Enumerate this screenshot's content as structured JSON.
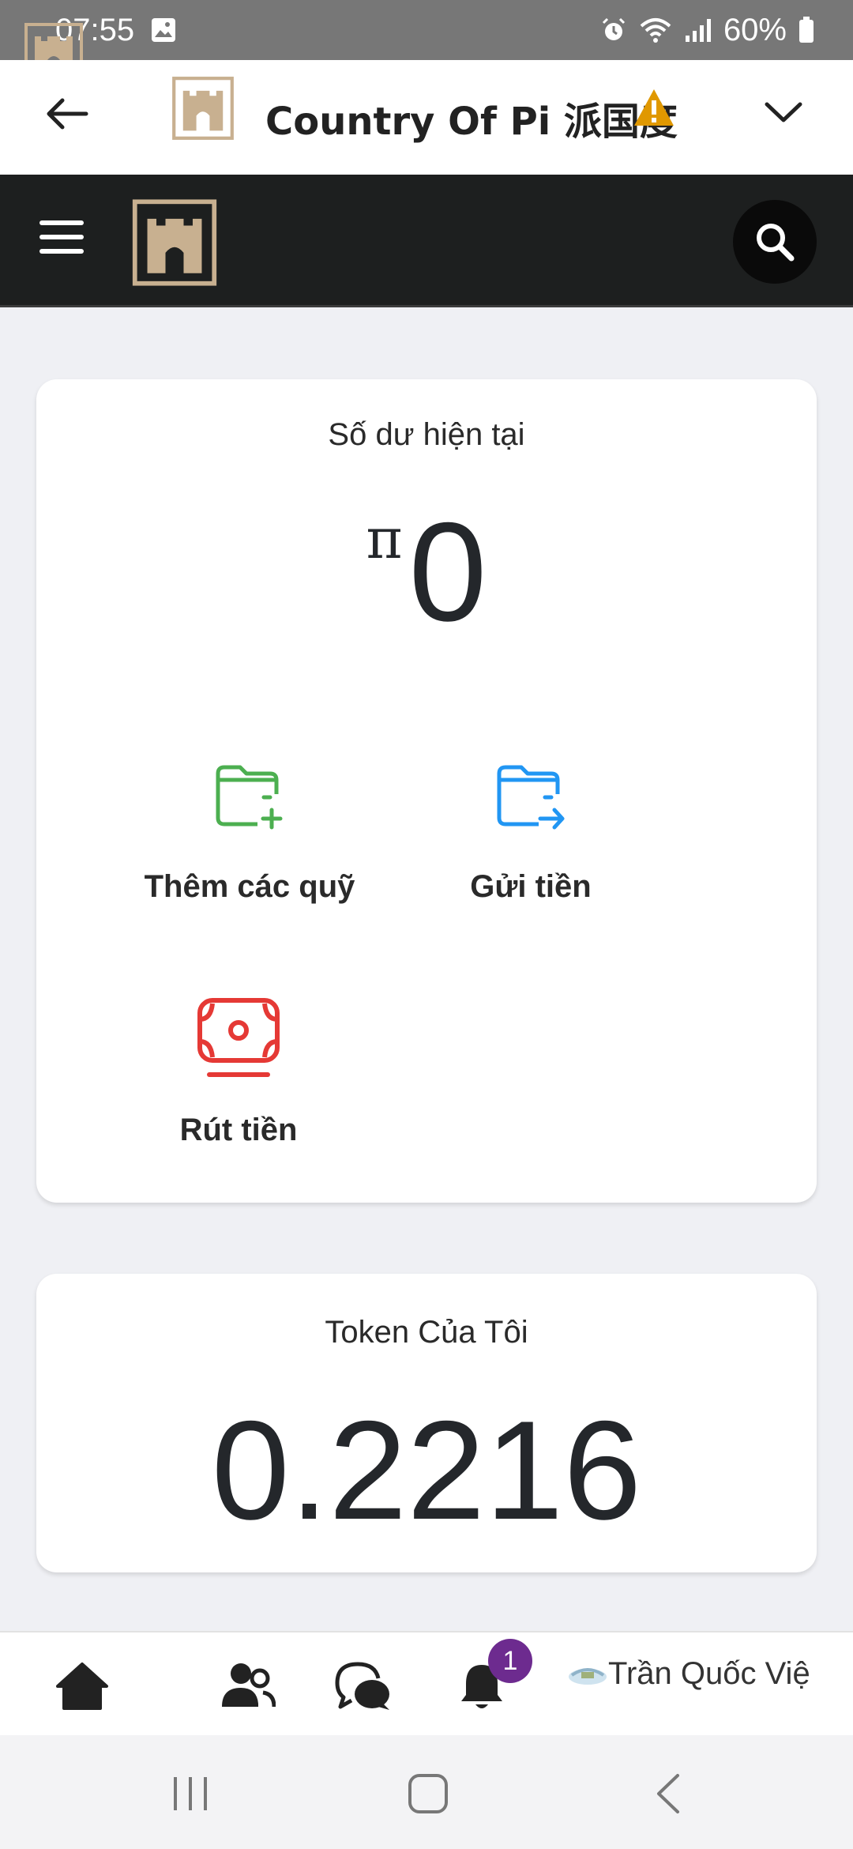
{
  "status_bar": {
    "time": "07:55",
    "battery": "60%",
    "icons": [
      "image-icon",
      "alarm-icon",
      "wifi-icon",
      "signal-icon",
      "battery-icon"
    ]
  },
  "app_bar": {
    "title": "Country Of Pi 派国度",
    "icons": [
      "back-arrow-icon",
      "castle-logo-icon",
      "warning-icon",
      "chevron-down-icon"
    ]
  },
  "site_header": {
    "icons": [
      "hamburger-menu-icon",
      "castle-logo-icon",
      "search-icon"
    ]
  },
  "balance_card": {
    "title": "Số dư hiện tại",
    "currency_symbol": "π",
    "amount": "0",
    "actions": [
      {
        "label": "Thêm các quỹ",
        "icon": "wallet-add-icon",
        "color": "#4caf50"
      },
      {
        "label": "Gửi tiền",
        "icon": "wallet-send-icon",
        "color": "#2196f3"
      },
      {
        "label": "Rút tiền",
        "icon": "cash-withdraw-icon",
        "color": "#e53935"
      }
    ]
  },
  "token_card": {
    "title": "Token Của Tôi",
    "value": "0.2216"
  },
  "bottom_nav": {
    "items": [
      "home-icon",
      "friends-icon",
      "chat-icon",
      "bell-icon"
    ],
    "notification_count": "1",
    "user_name": "Trần Quốc Việ"
  },
  "system_nav": {
    "buttons": [
      "recents-icon",
      "home-icon",
      "back-icon"
    ]
  },
  "colors": {
    "header_bg": "#1d1f1f",
    "logo": "#c8b090",
    "warning": "#e09800",
    "badge": "#6d2b8f"
  }
}
